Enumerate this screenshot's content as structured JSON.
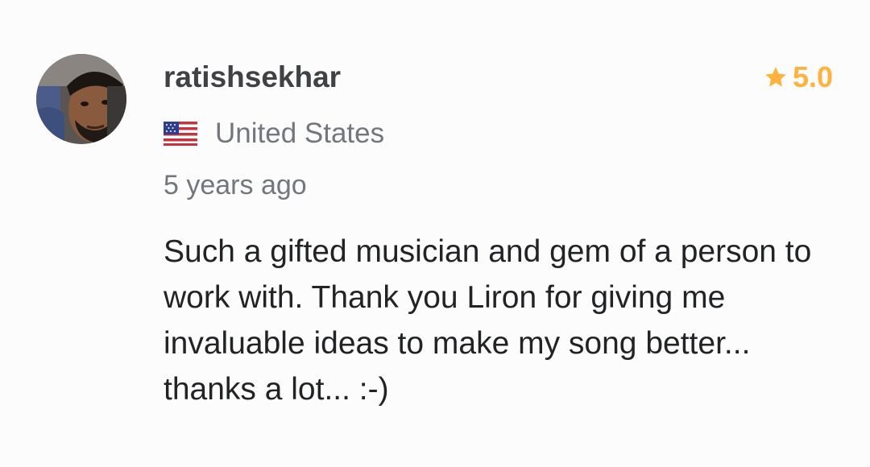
{
  "reviewer": {
    "username": "ratishsekhar",
    "country": "United States",
    "country_flag_icon": "us-flag-icon",
    "avatar_icon": "profile-photo"
  },
  "rating": {
    "value": "5.0",
    "icon": "star-icon",
    "color": "#ffb33e"
  },
  "time_ago": "5 years ago",
  "review_text": "Such a gifted musician and gem of a person to work with. Thank you Liron for giving me invaluable ideas to make my song better... thanks a lot... :-)"
}
